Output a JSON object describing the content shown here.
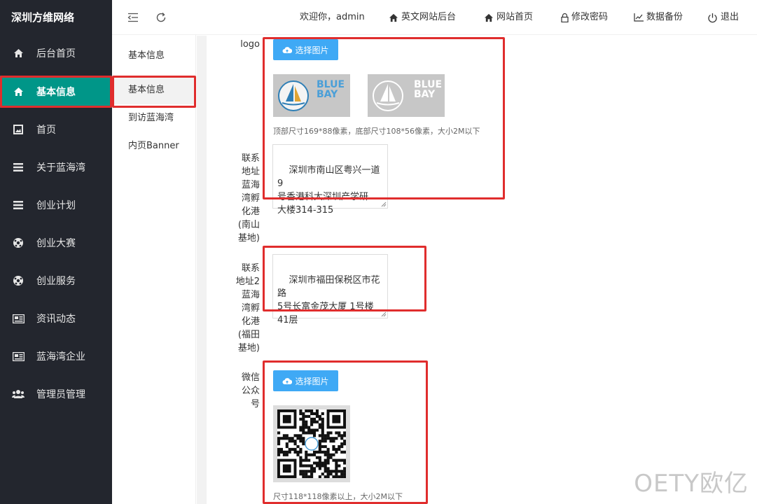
{
  "brand": "深圳方维网络",
  "sidebar": {
    "items": [
      {
        "label": "后台首页",
        "icon": "home-icon"
      },
      {
        "label": "基本信息",
        "icon": "home-icon",
        "active": true
      },
      {
        "label": "首页",
        "icon": "image-icon"
      },
      {
        "label": "关于蓝海湾",
        "icon": "list-icon"
      },
      {
        "label": "创业计划",
        "icon": "list-icon"
      },
      {
        "label": "创业大赛",
        "icon": "ball-icon"
      },
      {
        "label": "创业服务",
        "icon": "ball-icon"
      },
      {
        "label": "资讯动态",
        "icon": "news-icon"
      },
      {
        "label": "蓝海湾企业",
        "icon": "news-icon"
      },
      {
        "label": "管理员管理",
        "icon": "users-icon"
      }
    ]
  },
  "submenu": {
    "items": [
      {
        "label": "基本信息"
      },
      {
        "label": "基本信息",
        "active": true
      },
      {
        "label": "到访蓝海湾"
      },
      {
        "label": "内页Banner"
      }
    ]
  },
  "header": {
    "welcome": "欢迎你，admin",
    "links": [
      "英文网站后台",
      "网站首页",
      "修改密码",
      "数据备份",
      "退出"
    ]
  },
  "form": {
    "logo": {
      "label": "logo",
      "button": "选择图片",
      "logo_text_line1": "BLUE",
      "logo_text_line2": "BAY",
      "hint": "顶部尺寸169*88像素，底部尺寸108*56像素，大小2M以下"
    },
    "address1": {
      "label": "联系地址蓝海湾孵化港(南山基地)",
      "value": "深圳市南山区粤兴一道9\n号香港科大深圳产学研\n大楼314-315"
    },
    "address2": {
      "label": "联系地址2蓝海湾孵化港(福田基地)",
      "value": "深圳市福田保税区市花路\n5号长富金茂大厦 1号楼\n41层"
    },
    "wechat": {
      "label": "微信公众号",
      "button": "选择图片",
      "hint": "尺寸118*118像素以上，大小2M以下"
    }
  },
  "watermark": "OETY欧亿",
  "colors": {
    "sidebar_bg": "#23262e",
    "active_green": "#009688",
    "button_blue": "#3fa9f5",
    "highlight_red": "#e02d2d"
  }
}
